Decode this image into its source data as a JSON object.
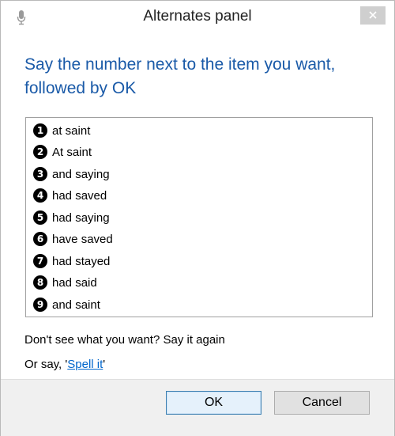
{
  "window": {
    "title": "Alternates panel"
  },
  "instruction": "Say the number next to the item you want, followed by OK",
  "alternates": [
    {
      "num": "1",
      "text": "at saint"
    },
    {
      "num": "2",
      "text": "At saint"
    },
    {
      "num": "3",
      "text": "and saying"
    },
    {
      "num": "4",
      "text": "had saved"
    },
    {
      "num": "5",
      "text": "had saying"
    },
    {
      "num": "6",
      "text": "have saved"
    },
    {
      "num": "7",
      "text": "had stayed"
    },
    {
      "num": "8",
      "text": "had said"
    },
    {
      "num": "9",
      "text": "and saint"
    }
  ],
  "hint": "Don't see what you want? Say it again",
  "spell": {
    "prefix": "Or say, '",
    "link": "Spell it",
    "suffix": "'"
  },
  "buttons": {
    "ok": "OK",
    "cancel": "Cancel"
  },
  "icons": {
    "title_icon": "microphone-icon",
    "close_icon": "close-icon"
  },
  "colors": {
    "instruction": "#1a5aa8",
    "link": "#0066cc"
  }
}
